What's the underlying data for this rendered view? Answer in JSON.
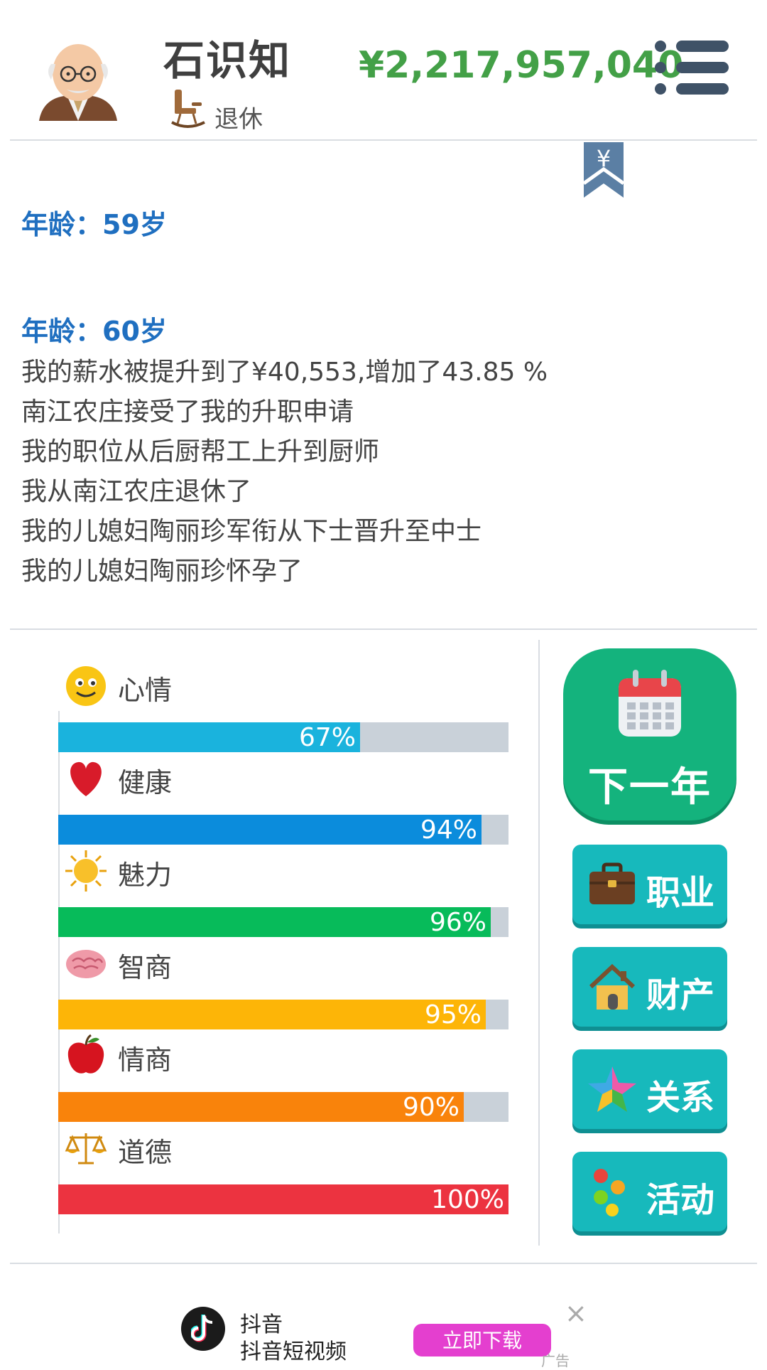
{
  "header": {
    "name": "石识知",
    "status": "退休",
    "money": "¥2,217,957,040"
  },
  "log": [
    {
      "age": "年龄：59岁",
      "lines": []
    },
    {
      "age": "年龄：60岁",
      "lines": [
        "我的薪水被提升到了¥40,553,增加了43.85 %",
        "南江农庄接受了我的升职申请",
        "我的职位从后厨帮工上升到厨师",
        "我从南江农庄退休了",
        "我的儿媳妇陶丽珍军衔从下士晋升至中士",
        "我的儿媳妇陶丽珍怀孕了"
      ]
    }
  ],
  "stats": [
    {
      "label": "心情",
      "percent": 67,
      "display": "67%",
      "color": "#1ab3dd",
      "icon": "smiley-icon"
    },
    {
      "label": "健康",
      "percent": 94,
      "display": "94%",
      "color": "#0b8cdc",
      "icon": "heart-icon"
    },
    {
      "label": "魅力",
      "percent": 96,
      "display": "96%",
      "color": "#07bb5a",
      "icon": "sun-icon"
    },
    {
      "label": "智商",
      "percent": 95,
      "display": "95%",
      "color": "#fdb507",
      "icon": "brain-icon"
    },
    {
      "label": "情商",
      "percent": 90,
      "display": "90%",
      "color": "#f9830b",
      "icon": "apple-icon"
    },
    {
      "label": "道德",
      "percent": 100,
      "display": "100%",
      "color": "#ec3340",
      "icon": "scales-icon"
    }
  ],
  "buttons": {
    "next_year": "下一年",
    "career": "职业",
    "assets": "财产",
    "relations": "关系",
    "activities": "活动"
  },
  "ad": {
    "title": "抖音",
    "subtitle": "抖音短视频",
    "cta": "立即下载",
    "close": "×",
    "tag": "广告"
  }
}
